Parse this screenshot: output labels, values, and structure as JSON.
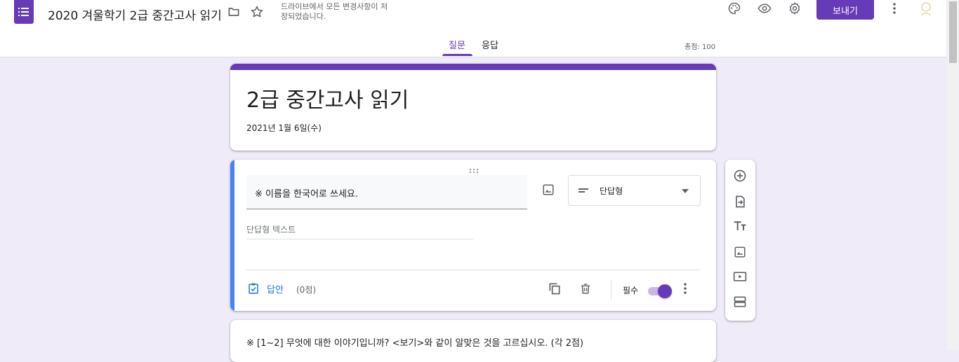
{
  "app": {
    "doc_title": "2020 겨울학기 2급 중간고사 읽기",
    "save_status": "드라이브에서 모든 변경사항이 저장되었습니다.",
    "send_label": "보내기"
  },
  "tabs": [
    {
      "label": "질문",
      "active": true
    },
    {
      "label": "응답",
      "active": false
    }
  ],
  "total_points": "총점: 100",
  "form": {
    "title": "2급 중간고사 읽기",
    "description": "2021년 1월 6일(수)"
  },
  "question": {
    "text": "※ 이름을 한국어로 쓰세요.",
    "type": "단답형",
    "answer_placeholder": "단답형 텍스트",
    "answer_key_label": "답안",
    "points": "(0점)",
    "required_label": "필수",
    "required": true
  },
  "next_question": {
    "text": "※ [1~2] 무엇에 대한 이야기입니까? <보기>와 같이 알맞은 것을 고르십시오. (각 2점)"
  },
  "colors": {
    "accent": "#673ab7",
    "background": "#f0ebf8",
    "active_question": "#4285f4",
    "link_blue": "#1a73e8"
  },
  "icons": [
    "forms-logo-icon",
    "folder-icon",
    "star-icon",
    "palette-icon",
    "preview-eye-icon",
    "settings-gear-icon",
    "more-vert-icon",
    "avatar",
    "drag-handle-icon",
    "image-icon",
    "short-answer-icon",
    "dropdown-arrow-icon",
    "answer-key-icon",
    "duplicate-icon",
    "delete-icon",
    "add-question-icon",
    "import-questions-icon",
    "add-title-icon",
    "add-image-icon",
    "add-video-icon",
    "add-section-icon"
  ]
}
